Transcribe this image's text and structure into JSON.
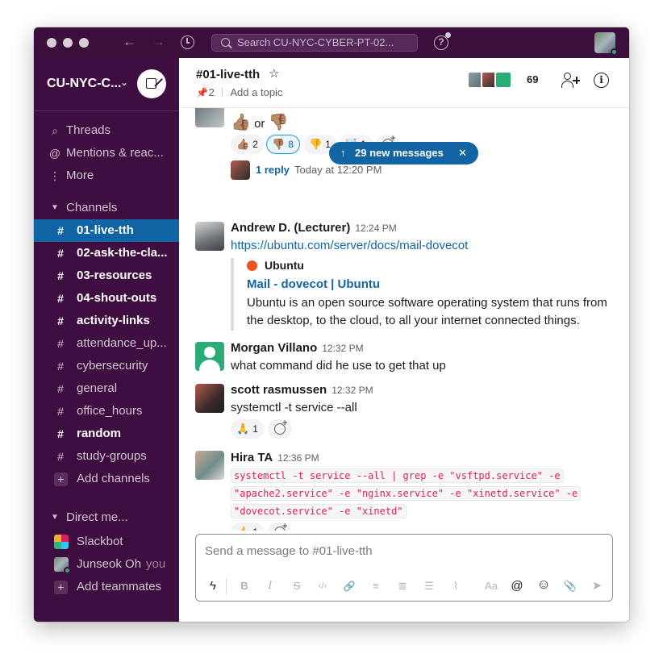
{
  "titlebar": {
    "search_placeholder": "Search CU-NYC-CYBER-PT-02...",
    "help_label": "?"
  },
  "sidebar": {
    "workspace_name": "CU-NYC-C...",
    "nav": [
      {
        "icon": "threads-icon",
        "glyph": "⌕",
        "label": "Threads"
      },
      {
        "icon": "mentions-icon",
        "glyph": "@",
        "label": "Mentions & reac..."
      },
      {
        "icon": "more-icon",
        "glyph": "⋮",
        "label": "More"
      }
    ],
    "channels_header": "Channels",
    "channels": [
      {
        "name": "01-live-tth",
        "state": "active"
      },
      {
        "name": "02-ask-the-cla...",
        "state": "unread"
      },
      {
        "name": "03-resources",
        "state": "unread"
      },
      {
        "name": "04-shout-outs",
        "state": "unread"
      },
      {
        "name": "activity-links",
        "state": "unread"
      },
      {
        "name": "attendance_up...",
        "state": "read"
      },
      {
        "name": "cybersecurity",
        "state": "read"
      },
      {
        "name": "general",
        "state": "read"
      },
      {
        "name": "office_hours",
        "state": "read"
      },
      {
        "name": "random",
        "state": "unread"
      },
      {
        "name": "study-groups",
        "state": "read"
      }
    ],
    "add_channels": "Add channels",
    "dm_header": "Direct me...",
    "dms": [
      {
        "name": "Slackbot",
        "you": ""
      },
      {
        "name": "Junseok Oh",
        "you": "you"
      }
    ],
    "add_teammates": "Add teammates"
  },
  "channel": {
    "title": "#01-live-tth",
    "star": "☆",
    "pins": "2",
    "topic": "Add a topic",
    "member_count": "69"
  },
  "banner": {
    "text": "29 new messages",
    "arrow": "↑",
    "close": "✕"
  },
  "messages": {
    "first": {
      "text_or": "or",
      "reactions": [
        {
          "emoji": "👍🏽",
          "count": "2",
          "mine": false
        },
        {
          "emoji": "👎🏽",
          "count": "8",
          "mine": true
        },
        {
          "emoji": "👎",
          "count": "1",
          "mine": false
        },
        {
          "emoji": "🤯",
          "count": "1",
          "mine": false
        }
      ],
      "reply_count": "1 reply",
      "reply_time": "Today at 12:20 PM"
    },
    "andrew": {
      "name": "Andrew D. (Lecturer)",
      "time": "12:24 PM",
      "link": "https://ubuntu.com/server/docs/mail-dovecot",
      "unfurl_site": "Ubuntu",
      "unfurl_title": "Mail - dovecot | Ubuntu",
      "unfurl_desc_1": "Ubuntu is an open source software operating system that runs from",
      "unfurl_desc_2": "the desktop, to the cloud, to all your internet connected things."
    },
    "morgan": {
      "name": "Morgan Villano",
      "time": "12:32 PM",
      "text": "what command did he use to get that up"
    },
    "scott": {
      "name": "scott rasmussen",
      "time": "12:32 PM",
      "text": "systemctl -t service --all",
      "reaction_emoji": "🙏",
      "reaction_count": "1"
    },
    "hira": {
      "name": "Hira TA",
      "time": "12:36 PM",
      "code_1": "systemctl -t service --all | grep -e \"vsftpd.service\" -e",
      "code_2": "\"apache2.service\" -e \"nginx.service\" -e \"xinetd.service\" -e",
      "code_3": "\"dovecot.service\" -e \"xinetd\"",
      "reaction_emoji": "👍",
      "reaction_count": "1"
    }
  },
  "composer": {
    "placeholder": "Send a message to #01-live-tth",
    "toolbar": [
      "ϟ",
      "B",
      "I",
      "S",
      "‹/›",
      "🔗",
      "≡",
      "≣",
      "☰",
      "⌇",
      "Aa",
      "@",
      "☺",
      "📎",
      "➤"
    ]
  },
  "colors": {
    "sidebar_bg": "#3f0e40",
    "active_channel": "#1164a3",
    "link": "#1264a3",
    "code_text": "#e01e5a",
    "online": "#2bac76"
  }
}
